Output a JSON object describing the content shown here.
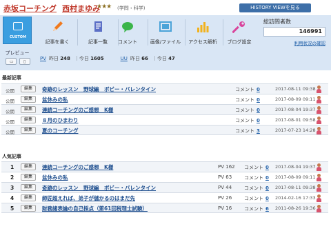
{
  "header": {
    "blog_title": "赤坂コーチング",
    "owner": "西村まゆみ",
    "stars": "★★★",
    "category": "(学問・科学)",
    "history_button": "HISTORY VIEWを見る"
  },
  "sidebar": {
    "custom_label": "CUSTOM",
    "preview_label": "プレビュー",
    "devices": [
      "pc-icon",
      "smartphone-icon"
    ]
  },
  "toolbar": {
    "items": [
      {
        "label": "記事を書く",
        "icon": "pencil-icon",
        "color": "#f07a1e"
      },
      {
        "label": "記事一覧",
        "icon": "document-list-icon",
        "color": "#5b6fc6"
      },
      {
        "label": "コメント",
        "icon": "speech-bubble-icon",
        "color": "#3bb54a"
      },
      {
        "label": "画像/ファイル",
        "icon": "image-file-icon",
        "color": "#4aa3d8"
      },
      {
        "label": "アクセス解析",
        "icon": "bar-chart-icon",
        "color": "#f2b21c"
      },
      {
        "label": "ブログ設定",
        "icon": "wrench-icon",
        "color": "#d9459c"
      }
    ]
  },
  "stats": {
    "pv_label": "PV",
    "uu_label": "UU",
    "yesterday_label": "昨日",
    "today_label": "今日",
    "pv_yesterday": "248",
    "pv_today": "1605",
    "uu_yesterday": "66",
    "uu_today": "47"
  },
  "visitors": {
    "title": "総訪問者数",
    "count": "146991",
    "link": "利用状況の確認"
  },
  "recent": {
    "title": "最新記事",
    "edit_label": "編集",
    "comment_label": "コメント",
    "rows": [
      {
        "status": "公開",
        "title": "奇跡のレッスン　野球編　ボビー・バレンタイン",
        "comments": "0",
        "date": "2017-08-11 09:38"
      },
      {
        "status": "公開",
        "title": "盆休みの私",
        "comments": "0",
        "date": "2017-08-09 09:11"
      },
      {
        "status": "公開",
        "title": "連続コーチングのご感想　K様",
        "comments": "0",
        "date": "2017-08-04 19:37"
      },
      {
        "status": "公開",
        "title": "８月のひまわり",
        "comments": "0",
        "date": "2017-08-01 09:58"
      },
      {
        "status": "公開",
        "title": "夏のコーチング",
        "comments": "3",
        "date": "2017-07-23 14:28"
      }
    ]
  },
  "popular": {
    "title": "人気記事",
    "edit_label": "編集",
    "pv_label": "PV",
    "comment_label": "コメント",
    "rows": [
      {
        "rank": "1",
        "title": "連続コーチングのご感想　K様",
        "pv": "162",
        "comments": "0",
        "date": "2017-08-04 19:37"
      },
      {
        "rank": "2",
        "title": "盆休みの私",
        "pv": "63",
        "comments": "0",
        "date": "2017-08-09 09:11"
      },
      {
        "rank": "3",
        "title": "奇跡のレッスン　野球編　ボビー・バレンタイン",
        "pv": "44",
        "comments": "0",
        "date": "2017-08-11 09:38"
      },
      {
        "rank": "4",
        "title": "師匠超えれば、弟子が儲かるのはまだ先",
        "pv": "26",
        "comments": "0",
        "date": "2014-02-16 17:33"
      },
      {
        "rank": "5",
        "title": "財務諸表論の自己採点（第61回税理士試験）",
        "pv": "16",
        "comments": "6",
        "date": "2011-08-26 19:36"
      }
    ]
  }
}
